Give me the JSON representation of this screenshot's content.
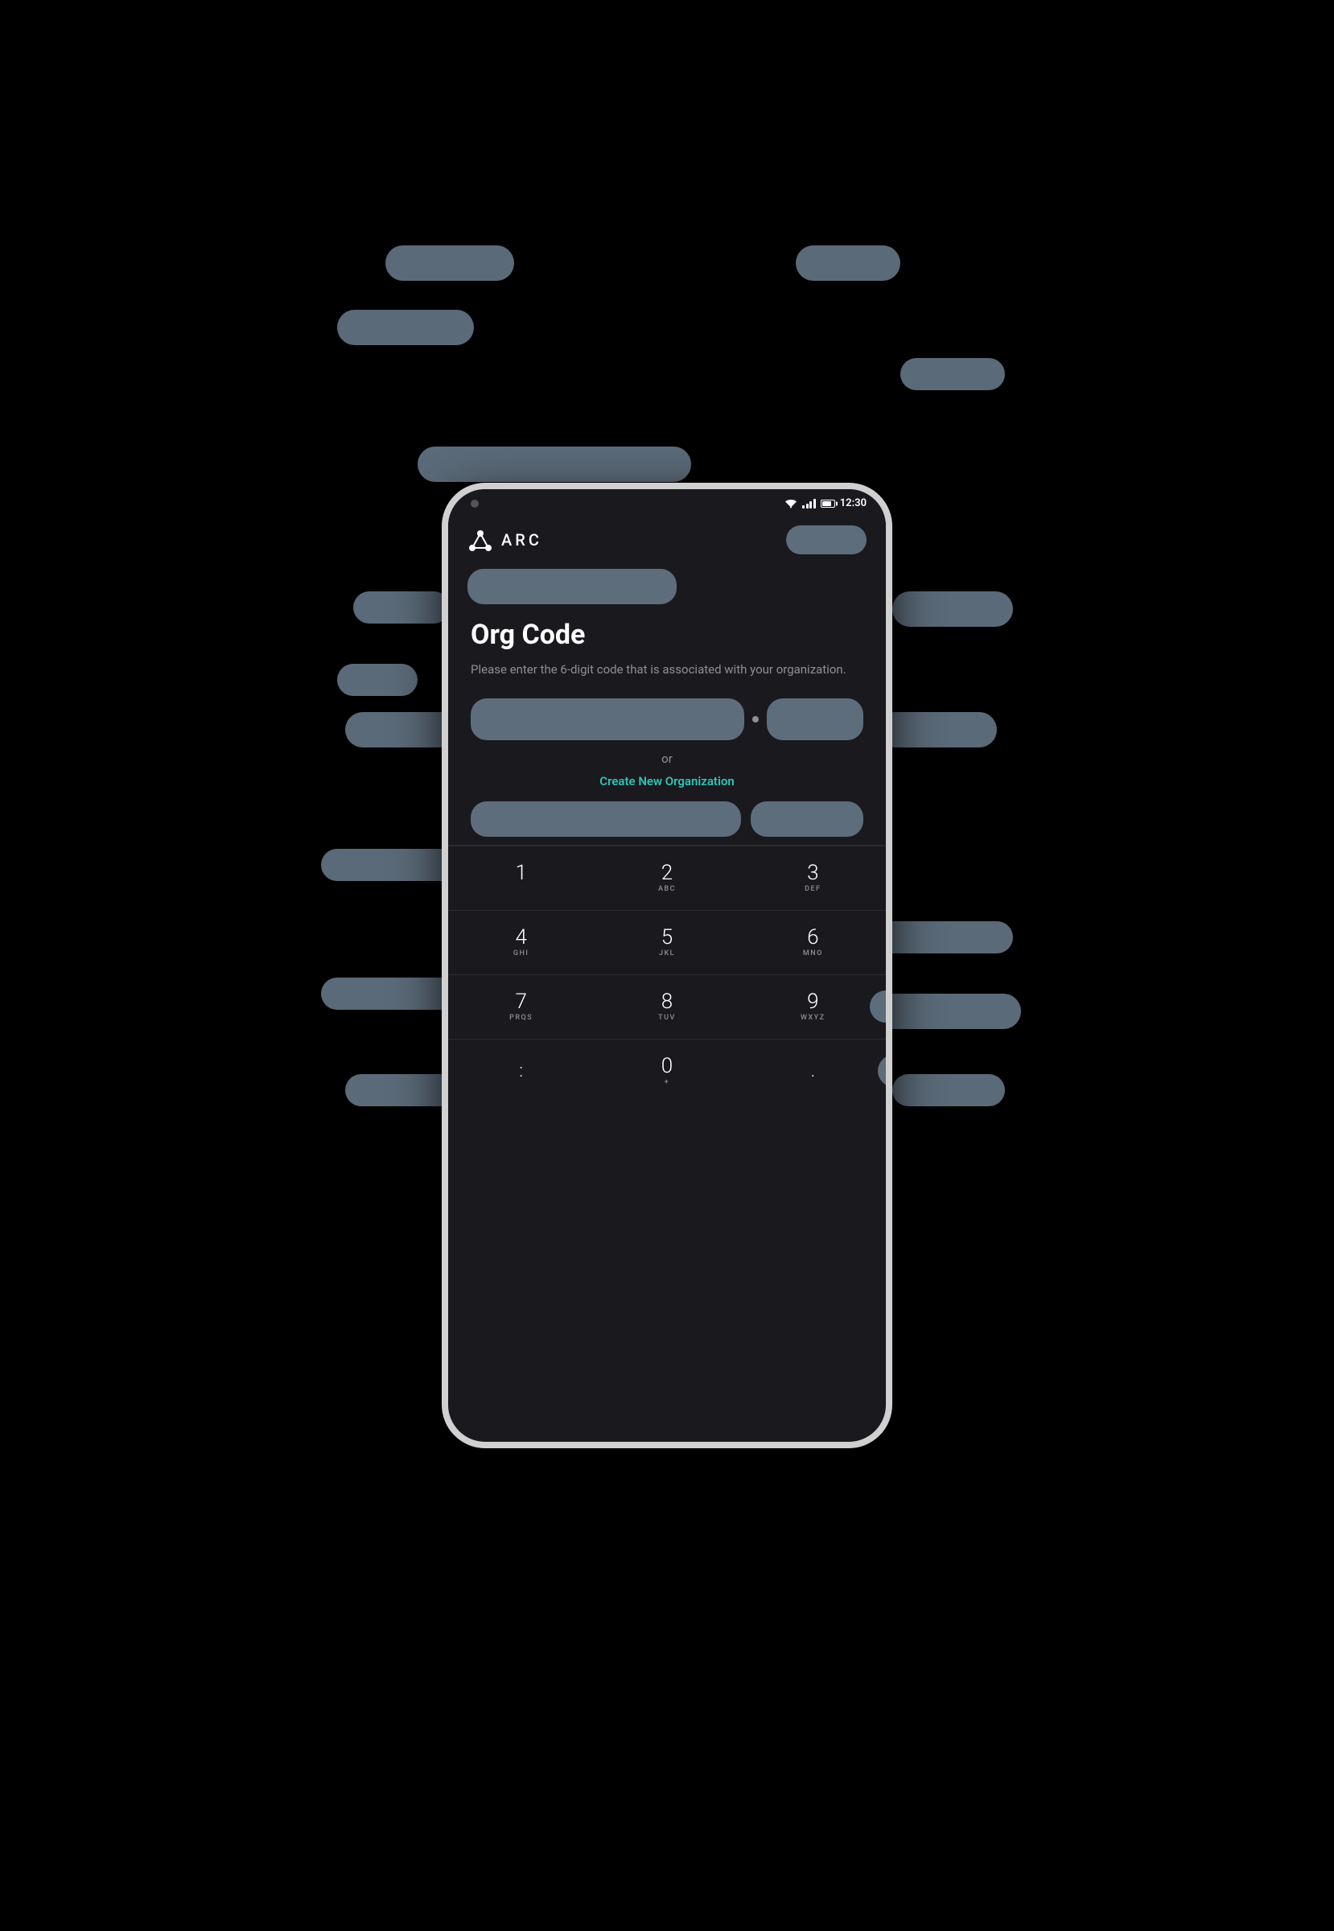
{
  "app": {
    "name": "ARC",
    "status_bar": {
      "time": "12:30"
    }
  },
  "page": {
    "title": "Org Code",
    "subtitle": "Please enter the 6-digit code that is associated with your organization.",
    "or_text": "or",
    "create_org_label": "Create New Organization"
  },
  "keypad": {
    "keys": [
      {
        "number": "1",
        "letters": ""
      },
      {
        "number": "2",
        "letters": "ABC"
      },
      {
        "number": "3",
        "letters": "DEF"
      },
      {
        "number": "4",
        "letters": "GHI"
      },
      {
        "number": "5",
        "letters": "JKL"
      },
      {
        "number": "6",
        "letters": "MNO"
      },
      {
        "number": "7",
        "letters": "PRQS"
      },
      {
        "number": "8",
        "letters": "TUV"
      },
      {
        "number": "9",
        "letters": "WXYZ"
      },
      {
        "number": ":",
        "letters": ""
      },
      {
        "number": "0",
        "letters": ""
      },
      {
        "number": ".",
        "letters": ""
      }
    ]
  },
  "colors": {
    "background": "#1a1a1e",
    "text_primary": "#ffffff",
    "text_secondary": "#8e8e93",
    "accent": "#2ec4b6",
    "annotation": "#6b7c8d"
  }
}
